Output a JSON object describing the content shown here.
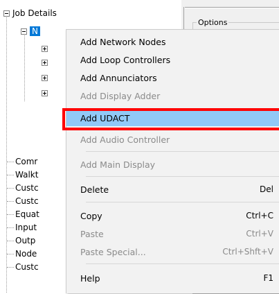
{
  "tree": {
    "root_label": "Job Details",
    "selected_child_label": "N",
    "bottom_items": [
      "Comr",
      "Walkt",
      "Custc",
      "Custc",
      "Equat",
      "Input",
      "Outp",
      "Node",
      "Custc"
    ]
  },
  "right_panel": {
    "group_label": "Options"
  },
  "context_menu": {
    "items": [
      {
        "label": "Add Network Nodes",
        "shortcut": "",
        "enabled": true
      },
      {
        "label": "Add Loop Controllers",
        "shortcut": "",
        "enabled": true
      },
      {
        "label": "Add Annunciators",
        "shortcut": "",
        "enabled": true
      },
      {
        "label": "Add Display Adder",
        "shortcut": "",
        "enabled": false
      },
      {
        "label": "Add UDACT",
        "shortcut": "",
        "enabled": true,
        "highlighted": true
      },
      {
        "label": "Add Audio Controller",
        "shortcut": "",
        "enabled": false
      },
      {
        "label": "Add Main Display",
        "shortcut": "",
        "enabled": false
      },
      {
        "label": "Delete",
        "shortcut": "Del",
        "enabled": true
      },
      {
        "label": "Copy",
        "shortcut": "Ctrl+C",
        "enabled": true
      },
      {
        "label": "Paste",
        "shortcut": "Ctrl+V",
        "enabled": false
      },
      {
        "label": "Paste Special...",
        "shortcut": "Ctrl+Shft+V",
        "enabled": false
      },
      {
        "label": "Help",
        "shortcut": "F1",
        "enabled": true
      }
    ]
  },
  "colors": {
    "selection_blue": "#0078d7",
    "menu_highlight": "#91c9f7",
    "annotation_red": "#ff0000",
    "disabled_text": "#8a8a8a"
  }
}
